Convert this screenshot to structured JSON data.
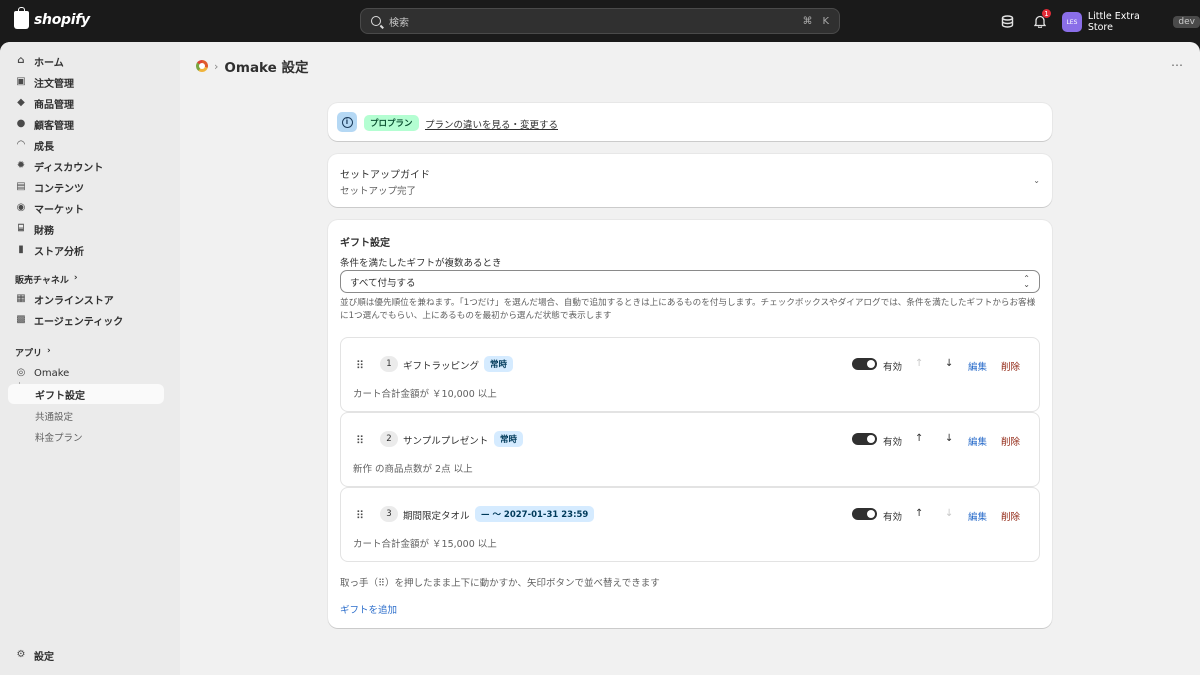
{
  "topbar": {
    "brand": "shopify",
    "search_placeholder": "検索",
    "shortcut_cmd": "⌘",
    "shortcut_key": "K",
    "notification_count": "1",
    "avatar_initials": "LES",
    "store_name": "Little Extra Store",
    "store_badge": "dev"
  },
  "sidebar": {
    "items": [
      {
        "label": "ホーム",
        "icon": "home-icon"
      },
      {
        "label": "注文管理",
        "icon": "inbox-icon"
      },
      {
        "label": "商品管理",
        "icon": "tag-icon"
      },
      {
        "label": "顧客管理",
        "icon": "person-icon"
      },
      {
        "label": "成長",
        "icon": "gauge-icon"
      },
      {
        "label": "ディスカウント",
        "icon": "discount-icon"
      },
      {
        "label": "コンテンツ",
        "icon": "content-icon"
      },
      {
        "label": "マーケット",
        "icon": "globe-icon"
      },
      {
        "label": "財務",
        "icon": "bank-icon"
      },
      {
        "label": "ストア分析",
        "icon": "bar-chart-icon"
      }
    ],
    "sales_channels_label": "販売チャネル",
    "channels": [
      {
        "label": "オンラインストア",
        "icon": "store-icon"
      },
      {
        "label": "エージェンティック",
        "icon": "agentic-icon"
      }
    ],
    "apps_label": "アプリ",
    "app_name": "Omake",
    "app_subitems": [
      "ギフト設定",
      "共通設定",
      "料金プラン"
    ],
    "settings_label": "設定"
  },
  "page": {
    "app": "Omake",
    "title": "Omake 設定"
  },
  "banner": {
    "plan_badge": "プロプラン",
    "link": "プランの違いを見る・変更する"
  },
  "setup_guide": {
    "title": "セットアップガイド",
    "status": "セットアップ完了"
  },
  "gift_settings": {
    "heading": "ギフト設定",
    "select_label": "条件を満たしたギフトが複数あるとき",
    "select_value": "すべて付与する",
    "help_text": "並び順は優先順位を兼ねます。「1つだけ」を選んだ場合、自動で追加するときは上にあるものを付与します。チェックボックスやダイアログでは、条件を満たしたギフトからお客様に1つ選んでもらい、上にあるものを最初から選んだ状態で表示します",
    "gifts": [
      {
        "num": "1",
        "name": "ギフトラッピング",
        "tag": "常時",
        "condition": "カート合計金額が ￥10,000 以上",
        "status": "有効",
        "enabled": true,
        "can_up": false,
        "can_down": true
      },
      {
        "num": "2",
        "name": "サンプルプレゼント",
        "tag": "常時",
        "condition": "新作 の商品点数が 2点 以上",
        "status": "有効",
        "enabled": true,
        "can_up": true,
        "can_down": true
      },
      {
        "num": "3",
        "name": "期間限定タオル",
        "tag": "— 〜 2027-01-31 23:59",
        "condition": "カート合計金額が ￥15,000 以上",
        "status": "有効",
        "enabled": true,
        "can_up": true,
        "can_down": false
      }
    ],
    "edit_label": "編集",
    "delete_label": "削除",
    "reorder_hint": "取っ手（⠿）を押したまま上下に動かすか、矢印ボタンで並べ替えできます",
    "add_label": "ギフトを追加"
  }
}
